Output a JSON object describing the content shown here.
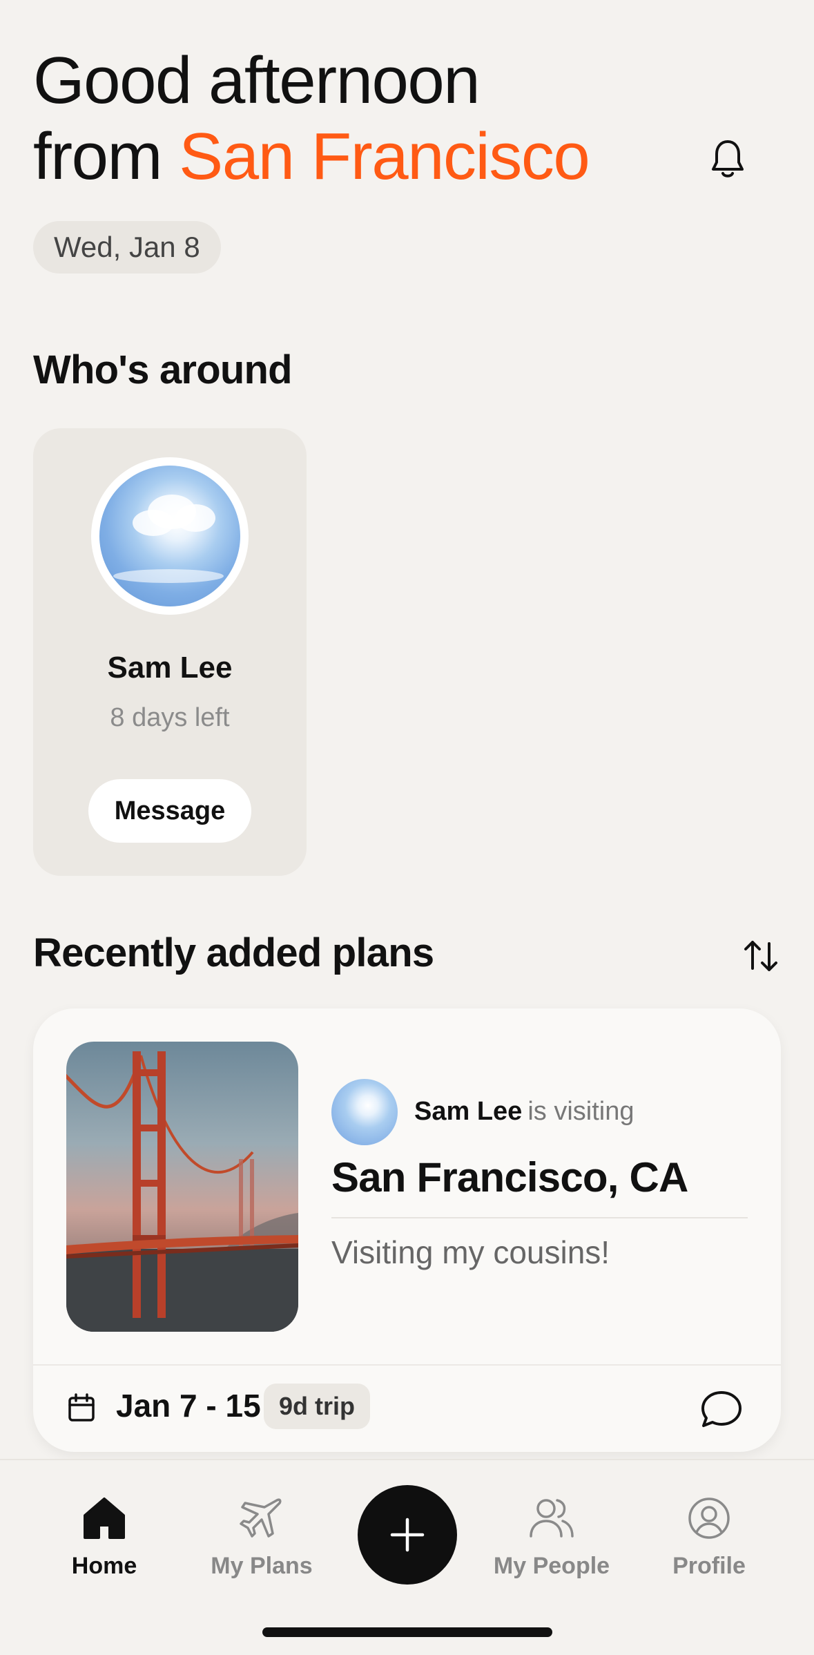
{
  "header": {
    "greeting_line1": "Good afternoon",
    "greeting_from": "from",
    "city": "San Francisco",
    "date": "Wed, Jan 8",
    "accent_color": "#ff5a14"
  },
  "whos_around": {
    "title": "Who's around",
    "people": [
      {
        "name": "Sam Lee",
        "status": "8 days left",
        "action_label": "Message",
        "avatar_icon": "sky-photo"
      }
    ]
  },
  "plans": {
    "title": "Recently added plans",
    "items": [
      {
        "photo": "golden-gate-bridge-photo",
        "visitor": "Sam Lee",
        "visiting_text": "is visiting",
        "destination": "San Francisco, CA",
        "note": "Visiting my cousins!",
        "dates": "Jan 7 - 15",
        "duration_badge": "9d trip"
      }
    ]
  },
  "tabbar": {
    "tabs": [
      {
        "label": "Home",
        "icon": "home-icon",
        "active": true
      },
      {
        "label": "My Plans",
        "icon": "plane-icon",
        "active": false
      },
      {
        "label": "My People",
        "icon": "people-icon",
        "active": false
      },
      {
        "label": "Profile",
        "icon": "profile-icon",
        "active": false
      }
    ],
    "fab_icon": "plus-icon"
  }
}
